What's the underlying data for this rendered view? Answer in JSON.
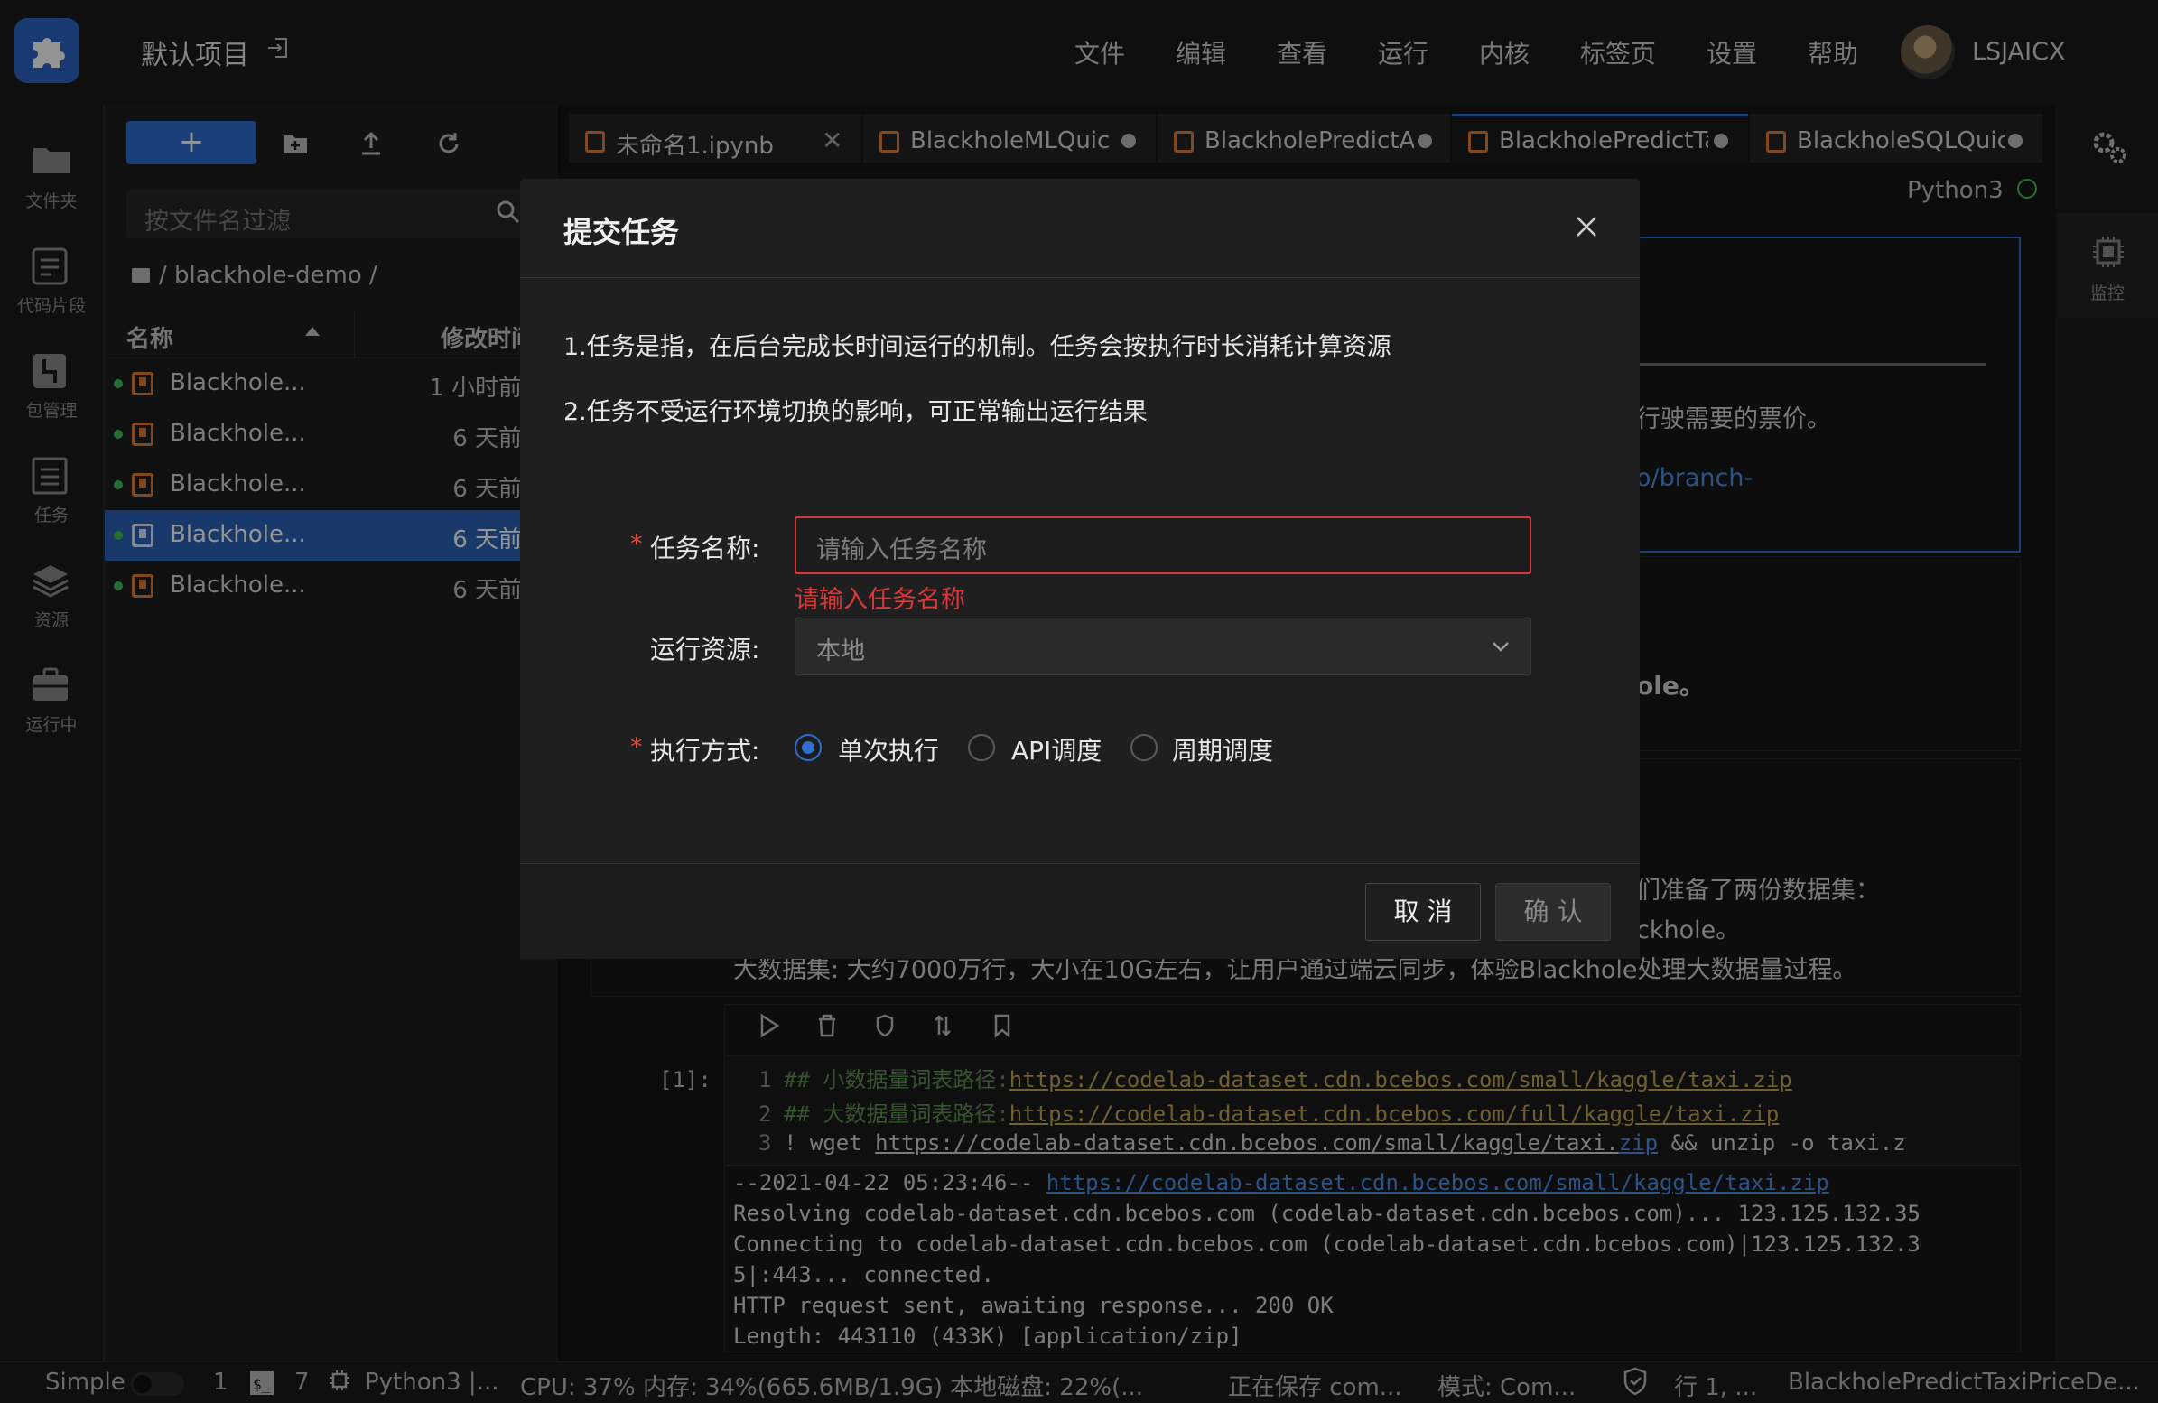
{
  "app": {
    "project_title": "默认项目",
    "menu": [
      "文件",
      "编辑",
      "查看",
      "运行",
      "内核",
      "标签页",
      "设置",
      "帮助"
    ],
    "username": "LSJAICX"
  },
  "activity_bar": [
    {
      "label": "文件夹",
      "icon": "folder-icon"
    },
    {
      "label": "代码片段",
      "icon": "snippet-icon"
    },
    {
      "label": "包管理",
      "icon": "package-icon"
    },
    {
      "label": "任务",
      "icon": "task-icon"
    },
    {
      "label": "资源",
      "icon": "layers-icon"
    },
    {
      "label": "运行中",
      "icon": "briefcase-icon"
    }
  ],
  "file_browser": {
    "new_label": "+",
    "filter_placeholder": "按文件名过滤",
    "breadcrumb": "/ blackhole-demo /",
    "col_name": "名称",
    "col_modified": "修改时间",
    "files": [
      {
        "name": "Blackhole...",
        "time": "1 小时前",
        "selected": false
      },
      {
        "name": "Blackhole...",
        "time": "6 天前",
        "selected": false
      },
      {
        "name": "Blackhole...",
        "time": "6 天前",
        "selected": false
      },
      {
        "name": "Blackhole...",
        "time": "6 天前",
        "selected": true
      },
      {
        "name": "Blackhole...",
        "time": "6 天前",
        "selected": false
      }
    ]
  },
  "tabs": [
    {
      "label": "未命名1.ipynb",
      "closable": true
    },
    {
      "label": "BlackholeMLQuick",
      "closable": false
    },
    {
      "label": "BlackholePredictAi",
      "closable": false
    },
    {
      "label": "BlackholePredictTa",
      "closable": false
    },
    {
      "label": "BlackholeSQLQuic",
      "closable": false
    }
  ],
  "kernel": "Python3",
  "right_panel": {
    "monitor_label": "监控"
  },
  "notebook": {
    "md_line1": "行驶需要的票价。",
    "md_link": "o/branch-",
    "md_bold": "ole。",
    "data_line1": "们准备了两份数据集：",
    "data_line2": "ckhole。",
    "data_line3": "大数据集: 大约7000万行，大小在10G左右，让用户通过端云同步，体验Blackhole处理大数据量过程。",
    "prompt": "[1]:",
    "code": [
      {
        "n": "1",
        "comment": "## 小数据量词表路径:",
        "url": "https://codelab-dataset.cdn.bcebos.com/small/kaggle/taxi.zip"
      },
      {
        "n": "2",
        "comment": "## 大数据量词表路径:",
        "url": "https://codelab-dataset.cdn.bcebos.com/full/kaggle/taxi.zip"
      },
      {
        "n": "3",
        "cmd": "! wget ",
        "url_a": "https://codelab-dataset.cdn.bcebos.com/small/kaggle/taxi.",
        "url_b": "zip",
        "rest": " && unzip -o taxi.z"
      }
    ],
    "output": {
      "l1_prefix": "--2021-04-22 05:23:46--  ",
      "l1_url": "https://codelab-dataset.cdn.bcebos.com/small/kaggle/taxi.zip",
      "l2": "Resolving codelab-dataset.cdn.bcebos.com (codelab-dataset.cdn.bcebos.com)... 123.125.132.35",
      "l3": "Connecting to codelab-dataset.cdn.bcebos.com (codelab-dataset.cdn.bcebos.com)|123.125.132.3",
      "l4": "5|:443... connected.",
      "l5": "HTTP request sent, awaiting response... 200 OK",
      "l6": "Length: 443110 (433K) [application/zip]"
    }
  },
  "status_bar": {
    "mode": "Simple",
    "count1": "1",
    "count2": "7",
    "kernel": "Python3 |...",
    "cpu_mem": "CPU:  37% 内存:  34%(665.6MB/1.9G) 本地磁盘:  22%(...",
    "saving": "正在保存 com...",
    "edit_mode": "模式:  Com...",
    "position": "行 1, ...",
    "file": "BlackholePredictTaxiPriceDe..."
  },
  "modal": {
    "title": "提交任务",
    "desc1": "1.任务是指，在后台完成长时间运行的机制。任务会按执行时长消耗计算资源",
    "desc2": "2.任务不受运行环境切换的影响，可正常输出运行结果",
    "name_label": "任务名称:",
    "name_placeholder": "请输入任务名称",
    "name_error": "请输入任务名称",
    "resource_label": "运行资源:",
    "resource_value": "本地",
    "exec_label": "执行方式:",
    "exec_options": [
      {
        "label": "单次执行",
        "checked": true
      },
      {
        "label": "API调度",
        "checked": false
      },
      {
        "label": "周期调度",
        "checked": false
      }
    ],
    "cancel": "取 消",
    "confirm": "确 认"
  },
  "colors": {
    "accent": "#2f6dd0",
    "error": "#d9383a",
    "notebook_icon": "#e07b2f",
    "kernel_idle": "#3fbf55"
  }
}
